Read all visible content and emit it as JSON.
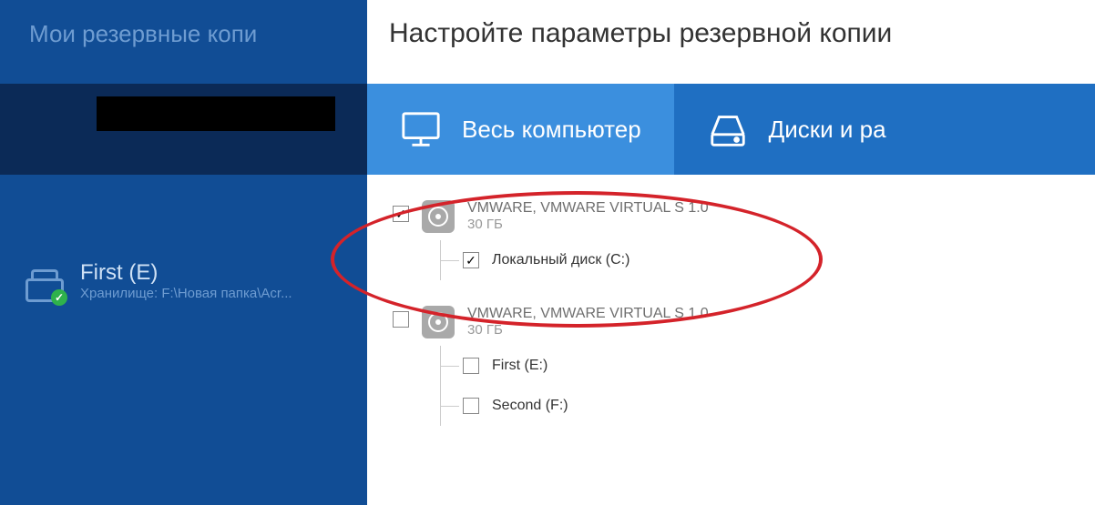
{
  "sidebar": {
    "title": "Мои резервные копи",
    "item": {
      "title": "First (E)",
      "storage_label": "Хранилище: F:\\Новая папка\\Acr...",
      "status_icon": "ok-badge"
    }
  },
  "main": {
    "heading": "Настройте параметры резервной копии",
    "tabs": [
      {
        "label": "Весь компьютер",
        "icon": "monitor-icon",
        "active": true
      },
      {
        "label": "Диски и ра",
        "icon": "drive-icon",
        "active": false
      }
    ],
    "disks": [
      {
        "name": "VMWARE, VMWARE VIRTUAL S 1.0",
        "size": "30 ГБ",
        "checked": true,
        "partitions": [
          {
            "label": "Локальный диск (C:)",
            "checked": true
          }
        ]
      },
      {
        "name": "VMWARE, VMWARE VIRTUAL S 1.0",
        "size": "30 ГБ",
        "checked": false,
        "partitions": [
          {
            "label": "First (E:)",
            "checked": false
          },
          {
            "label": "Second (F:)",
            "checked": false
          }
        ]
      }
    ]
  },
  "annotation": {
    "shape": "ellipse",
    "color": "#d4232a"
  }
}
